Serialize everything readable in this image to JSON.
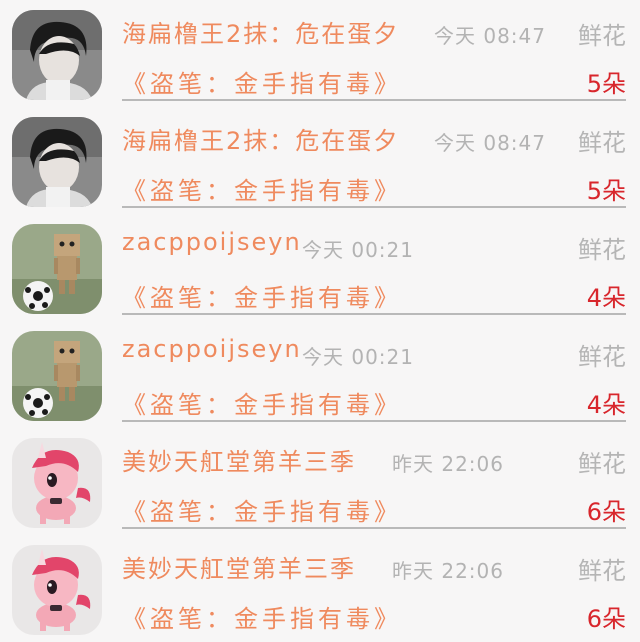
{
  "rows": [
    {
      "user": "海扁橹王2抹：危在蛋夕",
      "time": "今天 08:47",
      "gift": "鲜花",
      "book": "《盗笔：金手指有毒》",
      "count": "5朵",
      "avatar": "photo-avatar-icon"
    },
    {
      "user": "海扁橹王2抹：危在蛋夕",
      "time": "今天 08:47",
      "gift": "鲜花",
      "book": "《盗笔：金手指有毒》",
      "count": "5朵",
      "avatar": "photo-avatar-icon"
    },
    {
      "user": "zacppoijseyn",
      "time": "今天 00:21",
      "gift": "鲜花",
      "book": "《盗笔：金手指有毒》",
      "count": "4朵",
      "avatar": "danbo-soccer-avatar-icon"
    },
    {
      "user": "zacppoijseyn",
      "time": "今天 00:21",
      "gift": "鲜花",
      "book": "《盗笔：金手指有毒》",
      "count": "4朵",
      "avatar": "danbo-soccer-avatar-icon"
    },
    {
      "user": "美妙天舡堂第羊三季",
      "time": "昨天 22:06",
      "gift": "鲜花",
      "book": "《盗笔：金手指有毒》",
      "count": "6朵",
      "avatar": "pink-unicorn-avatar-icon"
    },
    {
      "user": "美妙天舡堂第羊三季",
      "time": "昨天 22:06",
      "gift": "鲜花",
      "book": "《盗笔：金手指有毒》",
      "count": "6朵",
      "avatar": "pink-unicorn-avatar-icon"
    }
  ],
  "colors": {
    "accent": "#ef8a5e",
    "count": "#d8262c",
    "muted": "#b3b3b3",
    "background": "#f7f6f6",
    "divider": "#b9b9b9"
  }
}
